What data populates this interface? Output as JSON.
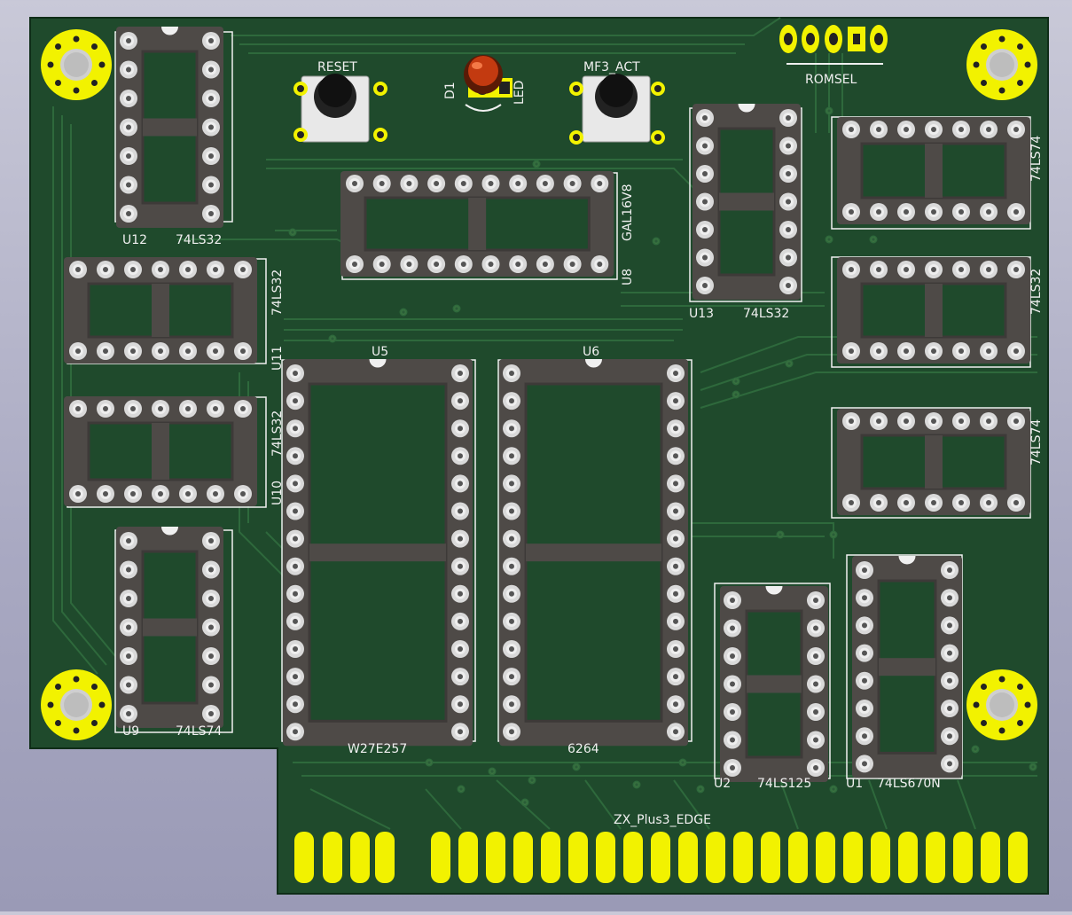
{
  "colors": {
    "board": "#1f4a2c",
    "board_edge": "#0f2d18",
    "trace": "#2f6b3d",
    "socket": "#4e4a47",
    "pad": "#d9d9d9",
    "gold": "#f2f200",
    "silk": "#f0f0f0",
    "led": "#c33a10"
  },
  "chips": [
    {
      "ref": "U12",
      "value": "74LS32"
    },
    {
      "ref": "U11",
      "value": "74LS32"
    },
    {
      "ref": "U10",
      "value": "74LS32"
    },
    {
      "ref": "U9",
      "value": "74LS74"
    },
    {
      "ref": "U8",
      "value": "GAL16V8"
    },
    {
      "ref": "U13",
      "value": "74LS32"
    },
    {
      "ref": "U5",
      "value": "W27E257"
    },
    {
      "ref": "U6",
      "value": "6264"
    },
    {
      "ref": "U2",
      "value": "74LS125"
    },
    {
      "ref": "U1",
      "value": "74LS670N"
    },
    {
      "value_right": "74LS74"
    },
    {
      "value_right": "74LS32"
    },
    {
      "value_right": "74LS74"
    }
  ],
  "buttons": {
    "reset": "RESET",
    "mf3": "MF3_ACT"
  },
  "led": {
    "ref": "D1",
    "value": "LED"
  },
  "header": {
    "label": "ROMSEL"
  },
  "edge": {
    "label": "ZX_Plus3_EDGE"
  }
}
